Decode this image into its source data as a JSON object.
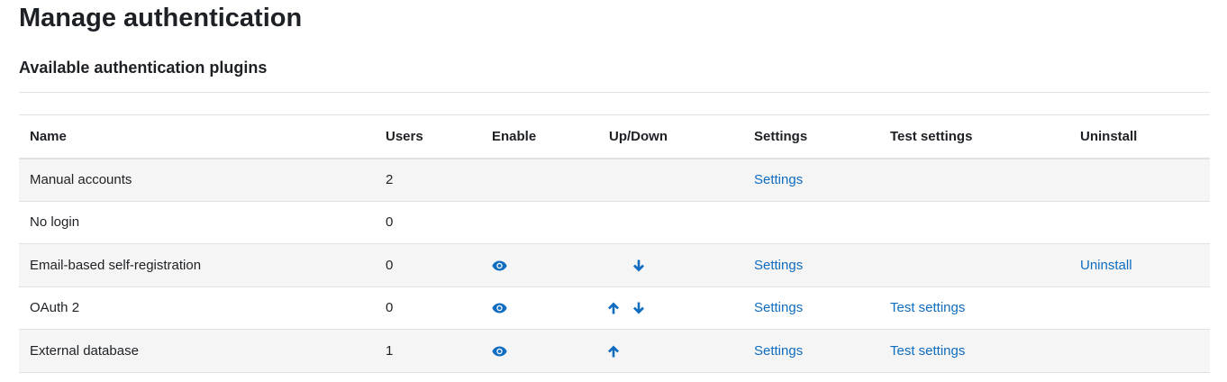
{
  "page": {
    "title": "Manage authentication",
    "section_title": "Available authentication plugins"
  },
  "colors": {
    "link": "#0f6cbf",
    "stripe": "#f5f5f5",
    "border": "#dee2e6"
  },
  "table": {
    "headers": [
      "Name",
      "Users",
      "Enable",
      "Up/Down",
      "Settings",
      "Test settings",
      "Uninstall"
    ],
    "rows": [
      {
        "name": "Manual accounts",
        "users": "2",
        "enable_icon": "",
        "up": false,
        "down": false,
        "settings": "Settings",
        "test_settings": "",
        "uninstall": ""
      },
      {
        "name": "No login",
        "users": "0",
        "enable_icon": "",
        "up": false,
        "down": false,
        "settings": "",
        "test_settings": "",
        "uninstall": ""
      },
      {
        "name": "Email-based self-registration",
        "users": "0",
        "enable_icon": "eye-icon",
        "up": false,
        "down": true,
        "settings": "Settings",
        "test_settings": "",
        "uninstall": "Uninstall"
      },
      {
        "name": "OAuth 2",
        "users": "0",
        "enable_icon": "eye-icon",
        "up": true,
        "down": true,
        "settings": "Settings",
        "test_settings": "Test settings",
        "uninstall": ""
      },
      {
        "name": "External database",
        "users": "1",
        "enable_icon": "eye-icon",
        "up": true,
        "down": false,
        "settings": "Settings",
        "test_settings": "Test settings",
        "uninstall": ""
      }
    ]
  }
}
